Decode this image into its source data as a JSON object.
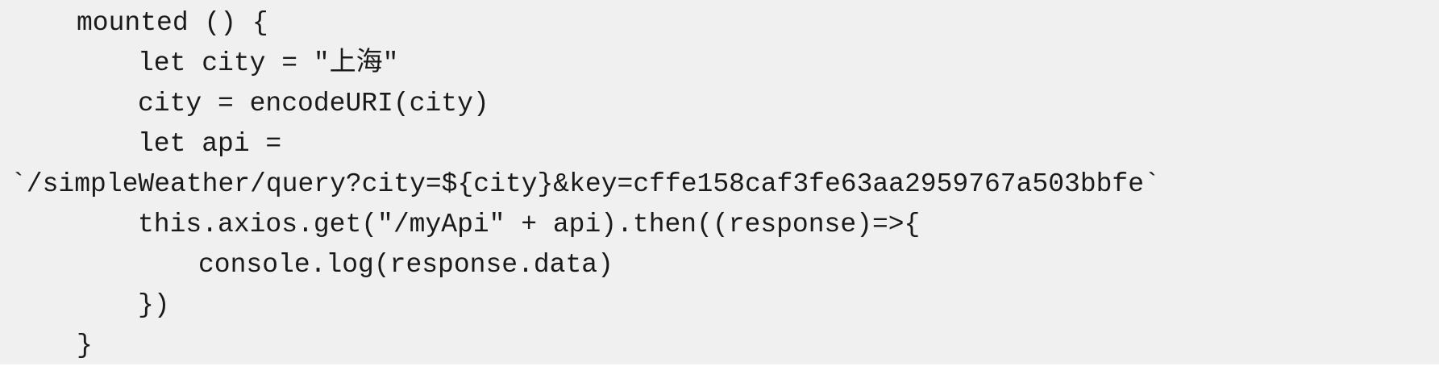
{
  "code": {
    "lines": [
      "mounted () {",
      "let city = \"上海\"",
      "city = encodeURI(city)",
      "let api =",
      "`/simpleWeather/query?city=${city}&key=cffe158caf3fe63aa2959767a503bbfe`",
      "this.axios.get(\"/myApi\" + api).then((response)=>{",
      "console.log(response.data)",
      "})",
      "}"
    ]
  },
  "colors": {
    "background": "#f0f0f0",
    "text": "#1a1a1a"
  }
}
